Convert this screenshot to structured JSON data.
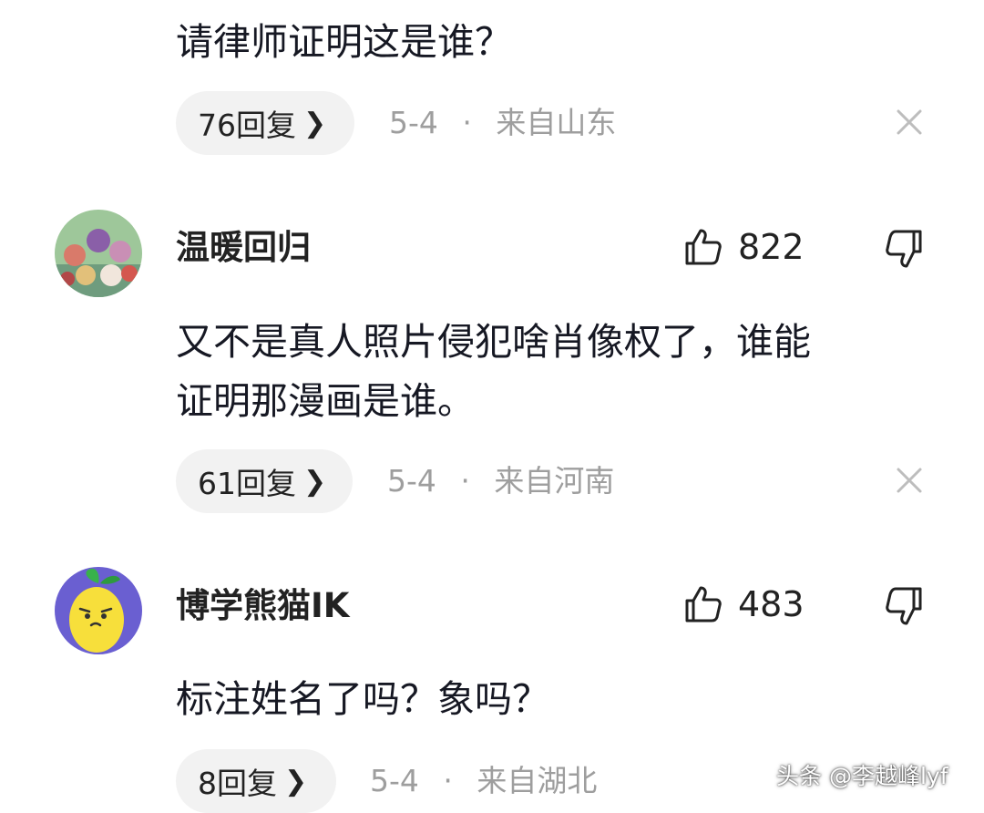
{
  "comments": [
    {
      "text_lines": [
        "请律师证明这是谁？"
      ],
      "replies_label": "76回复",
      "date": "5-4",
      "location": "来自山东"
    },
    {
      "username": "温暖回归",
      "likes": "822",
      "text_lines": [
        "又不是真人照片侵犯啥肖像权了，谁能",
        "证明那漫画是谁。"
      ],
      "replies_label": "61回复",
      "date": "5-4",
      "location": "来自河南"
    },
    {
      "username": "博学熊猫IK",
      "likes": "483",
      "text_lines": [
        "标注姓名了吗？象吗？"
      ],
      "replies_label": "8回复",
      "date": "5-4",
      "location": "来自湖北"
    }
  ],
  "separator": "·",
  "icons": {
    "chevron": "chevron-right-icon",
    "close": "close-icon",
    "like": "thumbs-up-icon",
    "dislike": "thumbs-down-icon"
  },
  "watermark": "头条 @李越峰lyf",
  "colors": {
    "text": "#161823",
    "meta": "#9e9e9e",
    "pill_bg": "#f2f2f2"
  }
}
